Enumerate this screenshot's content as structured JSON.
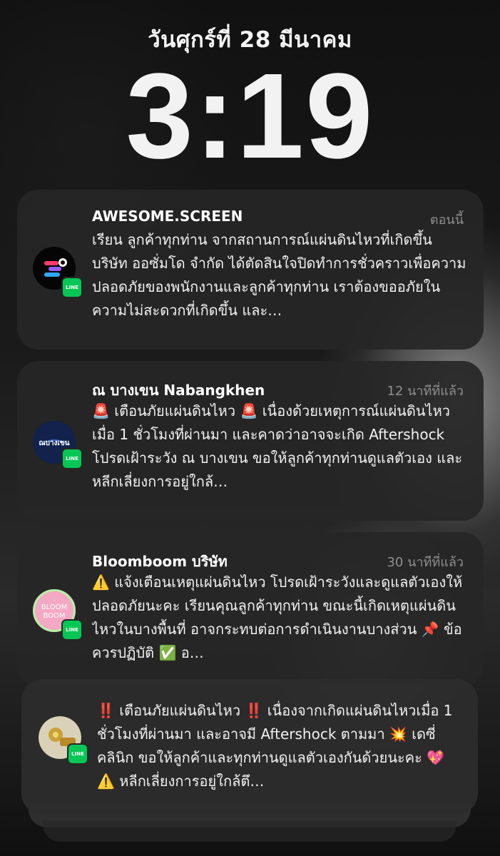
{
  "lockscreen": {
    "date": "วันศุกร์ที่ 28 มีนาคม",
    "time": "3:19"
  },
  "notifications": [
    {
      "app": "AWESOME.SCREEN",
      "time": "ตอนนี้",
      "text": "เรียน ลูกค้าทุกท่าน   จากสถานการณ์แผ่นดินไหวที่เกิดขึ้น บริษัท ออซั่มโด จำกัด ได้ตัดสินใจปิดทำการชั่วคราวเพื่อความปลอดภัยของพนักงานและลูกค้าทุกท่าน  เราต้องขออภัยในความไม่สะดวกที่เกิดขึ้น และ…",
      "badge": "LINE",
      "icon": "awesome-screen-logo"
    },
    {
      "app": "ณ บางเขน Nabangkhen",
      "time": "12 นาทีที่แล้ว",
      "text": "🚨 เตือนภัยแผ่นดินไหว 🚨 เนื่องด้วยเหตุการณ์แผ่นดินไหวเมื่อ 1 ชั่วโมงที่ผ่านมา และคาดว่าอาจจะเกิด Aftershock  โปรดเฝ้าระวัง  ณ บางเขน ขอให้ลูกค้าทุกท่านดูแลตัวเอง และหลีกเลี่ยงการอยู่ใกล้…",
      "badge": "LINE",
      "icon": "nabangkhen-logo",
      "logo_text": "ณบางเขน"
    },
    {
      "app": "Bloomboom บริษัท",
      "time": "30 นาทีที่แล้ว",
      "text": "⚠️ แจ้งเตือนเหตุแผ่นดินไหว โปรดเฝ้าระวังและดูแลตัวเองให้ปลอดภัยนะคะ   เรียนคุณลูกค้าทุกท่าน ขณะนี้เกิดเหตุแผ่นดินไหวในบางพื้นที่ อาจกระทบต่อการดำเนินงานบางส่วน   📌 ข้อควรปฏิบัติ  ✅ อ…",
      "badge": "LINE",
      "icon": "bloomboom-logo",
      "logo_line1": "BLOOM",
      "logo_line2": "BOOM"
    },
    {
      "app": "",
      "time": "",
      "text": "‼️ เตือนภัยแผ่นดินไหว ‼️  เนื่องจากเกิดแผ่นดินไหวเมื่อ 1 ชั่วโมงที่ผ่านมา และอาจมี Aftershock ตามมา  💥 เดซี่คลินิก ขอให้ลูกค้าและทุกท่านดูแลตัวเองกันด้วยนะคะ 💖  ⚠️ หลีกเลี่ยงการอยู่ใกล้ตึ…",
      "badge": "LINE",
      "icon": "daisy-clinic-logo"
    }
  ],
  "colors": {
    "line_green": "#06c755",
    "card_bg": "#262626",
    "muted_text": "#8e8e8e"
  }
}
